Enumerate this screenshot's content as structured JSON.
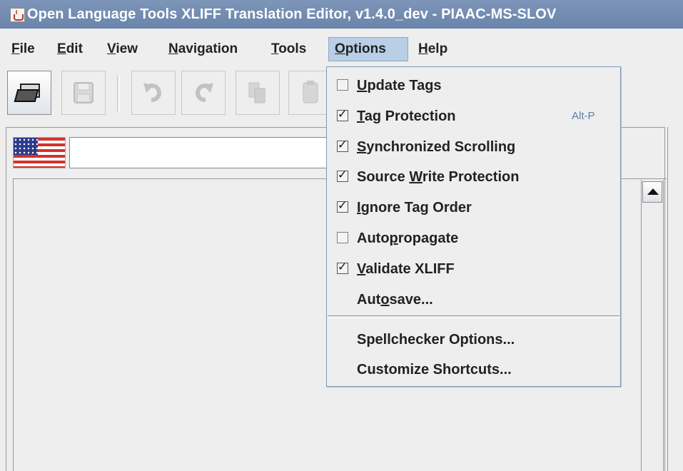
{
  "window": {
    "title": "Open Language Tools XLIFF Translation Editor, v1.4.0_dev - PIAAC-MS-SLOV",
    "app_icon": "java-cup-icon"
  },
  "menubar": {
    "items": [
      {
        "id": "file",
        "pre": "",
        "mn": "F",
        "post": "ile"
      },
      {
        "id": "edit",
        "pre": "",
        "mn": "E",
        "post": "dit"
      },
      {
        "id": "view",
        "pre": "",
        "mn": "V",
        "post": "iew"
      },
      {
        "id": "navigation",
        "pre": "",
        "mn": "N",
        "post": "avigation"
      },
      {
        "id": "tools",
        "pre": "",
        "mn": "T",
        "post": "ools"
      },
      {
        "id": "options",
        "pre": "",
        "mn": "O",
        "post": "ptions"
      },
      {
        "id": "help",
        "pre": "",
        "mn": "H",
        "post": "elp"
      }
    ]
  },
  "toolbar": {
    "buttons": [
      "open-folder-icon",
      "save-icon",
      "undo-icon",
      "redo-icon",
      "copy-icon",
      "paste-icon"
    ]
  },
  "options_menu": {
    "items": [
      {
        "checkbox": true,
        "checked": false,
        "pre": "",
        "mn": "U",
        "post": "pdate Tags",
        "shortcut": ""
      },
      {
        "checkbox": true,
        "checked": true,
        "pre": "",
        "mn": "T",
        "post": "ag Protection",
        "shortcut": "Alt-P"
      },
      {
        "checkbox": true,
        "checked": true,
        "pre": "",
        "mn": "S",
        "post": "ynchronized Scrolling",
        "shortcut": ""
      },
      {
        "checkbox": true,
        "checked": true,
        "pre": "Source ",
        "mn": "W",
        "post": "rite Protection",
        "shortcut": ""
      },
      {
        "checkbox": true,
        "checked": true,
        "pre": "",
        "mn": "I",
        "post": "gnore Tag Order",
        "shortcut": ""
      },
      {
        "checkbox": true,
        "checked": false,
        "pre": "Auto",
        "mn": "p",
        "post": "ropagate",
        "shortcut": ""
      },
      {
        "checkbox": true,
        "checked": true,
        "pre": "",
        "mn": "V",
        "post": "alidate XLIFF",
        "shortcut": ""
      },
      {
        "checkbox": false,
        "checked": false,
        "pre": "Aut",
        "mn": "o",
        "post": "save...",
        "shortcut": ""
      },
      {
        "checkbox": false,
        "checked": false,
        "pre": "Spellchecker Options...",
        "mn": "",
        "post": "",
        "shortcut": ""
      },
      {
        "checkbox": false,
        "checked": false,
        "pre": "Customize Shortcuts...",
        "mn": "",
        "post": "",
        "shortcut": ""
      }
    ]
  },
  "editor": {
    "source_language_flag": "us-flag-icon",
    "language_field_value": ""
  }
}
